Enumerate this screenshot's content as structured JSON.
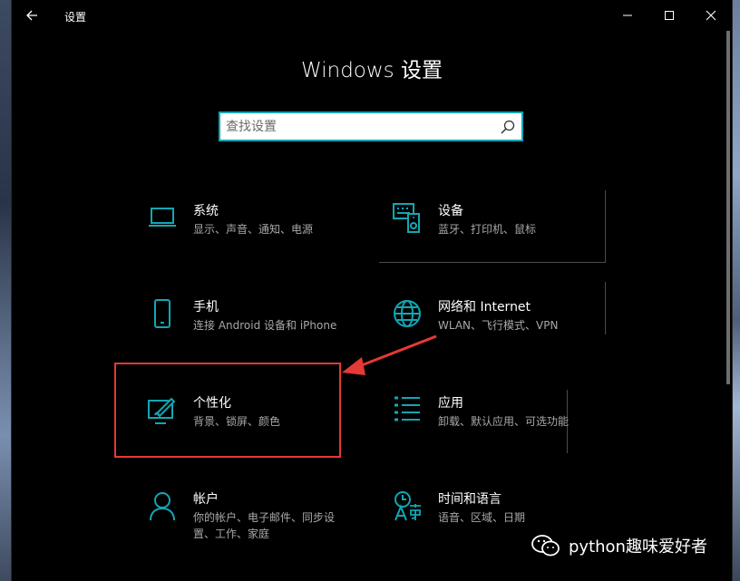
{
  "window": {
    "title": "设置",
    "heading": "Windows 设置"
  },
  "search": {
    "placeholder": "查找设置",
    "value": ""
  },
  "tiles": [
    {
      "id": "system",
      "title": "系统",
      "desc": "显示、声音、通知、电源",
      "icon": "laptop-icon"
    },
    {
      "id": "devices",
      "title": "设备",
      "desc": "蓝牙、打印机、鼠标",
      "icon": "keyboard-speaker-icon"
    },
    {
      "id": "phone",
      "title": "手机",
      "desc": "连接 Android 设备和 iPhone",
      "icon": "phone-icon"
    },
    {
      "id": "network",
      "title": "网络和 Internet",
      "desc": "WLAN、飞行模式、VPN",
      "icon": "globe-icon"
    },
    {
      "id": "personalization",
      "title": "个性化",
      "desc": "背景、锁屏、颜色",
      "icon": "paint-brush-icon"
    },
    {
      "id": "apps",
      "title": "应用",
      "desc": "卸载、默认应用、可选功能",
      "icon": "apps-list-icon"
    },
    {
      "id": "accounts",
      "title": "帐户",
      "desc": "你的帐户、电子邮件、同步设置、工作、家庭",
      "icon": "person-icon"
    },
    {
      "id": "time-language",
      "title": "时间和语言",
      "desc": "语音、区域、日期",
      "icon": "time-language-icon"
    }
  ],
  "watermark": {
    "text": "python趣味爱好者",
    "icon": "wechat-icon"
  },
  "colors": {
    "accent": "#12a7b4",
    "highlight": "#e53935",
    "background": "#000000"
  }
}
